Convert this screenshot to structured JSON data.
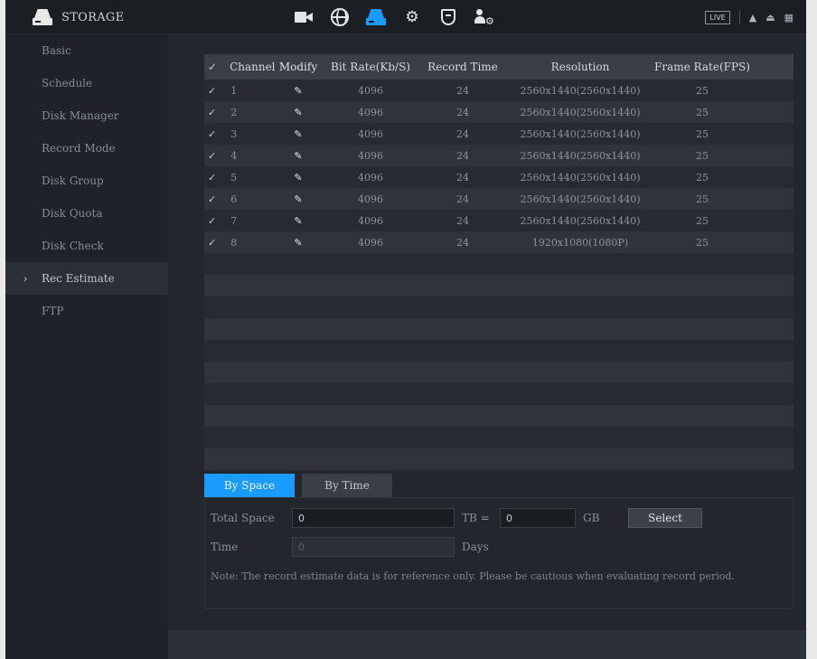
{
  "header": {
    "title": "STORAGE",
    "nav_icons": [
      {
        "name": "camera-icon",
        "active": false
      },
      {
        "name": "network-icon",
        "active": false
      },
      {
        "name": "storage-icon",
        "active": true
      },
      {
        "name": "system-gears-icon",
        "active": false
      },
      {
        "name": "security-shield-icon",
        "active": false
      },
      {
        "name": "account-icon",
        "active": false
      }
    ],
    "live_label": "LIVE",
    "accent_color": "#1a9cff"
  },
  "sidebar": {
    "items": [
      {
        "label": "Basic",
        "active": false
      },
      {
        "label": "Schedule",
        "active": false
      },
      {
        "label": "Disk Manager",
        "active": false
      },
      {
        "label": "Record Mode",
        "active": false
      },
      {
        "label": "Disk Group",
        "active": false
      },
      {
        "label": "Disk Quota",
        "active": false
      },
      {
        "label": "Disk Check",
        "active": false
      },
      {
        "label": "Rec Estimate",
        "active": true
      },
      {
        "label": "FTP",
        "active": false
      }
    ]
  },
  "table": {
    "headers": {
      "check": "✓",
      "channel": "Channel",
      "modify": "Modify",
      "bitrate": "Bit Rate(Kb/S)",
      "record_time": "Record Time",
      "resolution": "Resolution",
      "fps": "Frame Rate(FPS)"
    },
    "rows": [
      {
        "check": "✓",
        "channel": "1",
        "modify": "✎",
        "bitrate": "4096",
        "record_time": "24",
        "resolution": "2560x1440(2560x1440)",
        "fps": "25"
      },
      {
        "check": "✓",
        "channel": "2",
        "modify": "✎",
        "bitrate": "4096",
        "record_time": "24",
        "resolution": "2560x1440(2560x1440)",
        "fps": "25"
      },
      {
        "check": "✓",
        "channel": "3",
        "modify": "✎",
        "bitrate": "4096",
        "record_time": "24",
        "resolution": "2560x1440(2560x1440)",
        "fps": "25"
      },
      {
        "check": "✓",
        "channel": "4",
        "modify": "✎",
        "bitrate": "4096",
        "record_time": "24",
        "resolution": "2560x1440(2560x1440)",
        "fps": "25"
      },
      {
        "check": "✓",
        "channel": "5",
        "modify": "✎",
        "bitrate": "4096",
        "record_time": "24",
        "resolution": "2560x1440(2560x1440)",
        "fps": "25"
      },
      {
        "check": "✓",
        "channel": "6",
        "modify": "✎",
        "bitrate": "4096",
        "record_time": "24",
        "resolution": "2560x1440(2560x1440)",
        "fps": "25"
      },
      {
        "check": "✓",
        "channel": "7",
        "modify": "✎",
        "bitrate": "4096",
        "record_time": "24",
        "resolution": "2560x1440(2560x1440)",
        "fps": "25"
      },
      {
        "check": "✓",
        "channel": "8",
        "modify": "✎",
        "bitrate": "4096",
        "record_time": "24",
        "resolution": "1920x1080(1080P)",
        "fps": "25"
      }
    ]
  },
  "tabs": [
    {
      "label": "By Space",
      "active": true
    },
    {
      "label": "By Time",
      "active": false
    }
  ],
  "form": {
    "total_space_label": "Total Space",
    "total_space_value": "0",
    "tb_unit": "TB =",
    "gb_value": "0",
    "gb_unit": "GB",
    "select_label": "Select",
    "time_label": "Time",
    "time_value": "0",
    "days_unit": "Days",
    "note": "Note: The record estimate data is for reference only. Please be cautious when evaluating record period."
  }
}
